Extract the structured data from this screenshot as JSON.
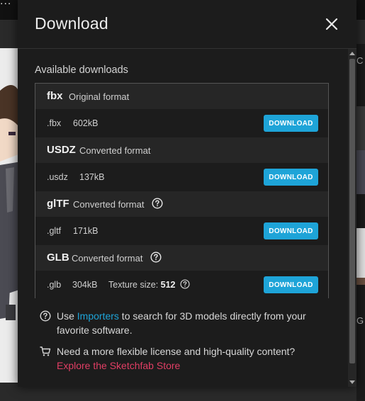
{
  "background": {
    "topbar_text": "...",
    "right_letters": [
      "C",
      "G"
    ]
  },
  "modal": {
    "title": "Download",
    "available_label": "Available downloads",
    "formats": [
      {
        "name": "fbx",
        "description": "Original format",
        "has_help": false,
        "file": {
          "ext": ".fbx",
          "size": "602kB",
          "button": "DOWNLOAD"
        }
      },
      {
        "name": "USDZ",
        "description": "Converted format",
        "has_help": false,
        "file": {
          "ext": ".usdz",
          "size": "137kB",
          "button": "DOWNLOAD"
        }
      },
      {
        "name": "glTF",
        "description": "Converted format",
        "has_help": true,
        "file": {
          "ext": ".gltf",
          "size": "171kB",
          "button": "DOWNLOAD"
        }
      },
      {
        "name": "GLB",
        "description": "Converted format",
        "has_help": true,
        "file": {
          "ext": ".glb",
          "size": "304kB",
          "texture_label": "Texture size:",
          "texture_value": "512",
          "button": "DOWNLOAD"
        }
      }
    ],
    "importers": {
      "prefix": "Use ",
      "link": "Importers",
      "suffix": " to search for 3D models directly from your favorite software."
    },
    "store": {
      "text": "Need a more flexible license and high-quality content?",
      "link": "Explore the Sketchfab Store"
    }
  },
  "colors": {
    "accent": "#1ea4d8",
    "store_link": "#e03e64",
    "modal_bg": "#1c1c1c"
  },
  "icons": [
    "close-icon",
    "help-icon",
    "cart-icon",
    "scroll-up-icon",
    "scroll-down-icon"
  ]
}
